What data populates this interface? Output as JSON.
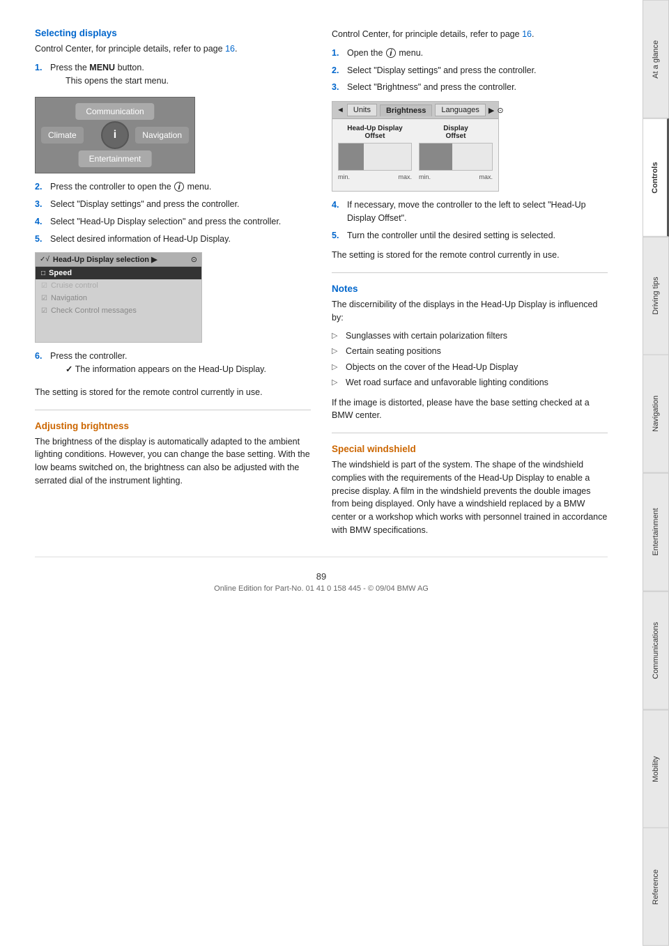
{
  "sidebar": {
    "tabs": [
      {
        "label": "At a glance",
        "active": false
      },
      {
        "label": "Controls",
        "active": true
      },
      {
        "label": "Driving tips",
        "active": false
      },
      {
        "label": "Navigation",
        "active": false
      },
      {
        "label": "Entertainment",
        "active": false
      },
      {
        "label": "Communications",
        "active": false
      },
      {
        "label": "Mobility",
        "active": false
      },
      {
        "label": "Reference",
        "active": false
      }
    ]
  },
  "left_col": {
    "selecting_displays": {
      "heading": "Selecting displays",
      "intro": "Control Center, for principle details, refer to page",
      "intro_page": "16",
      "intro_end": ".",
      "steps": [
        {
          "num": "1.",
          "text": "Press the ",
          "bold": "MENU",
          "text2": " button.",
          "sub": "This opens the start menu."
        },
        {
          "num": "2.",
          "text": "Press the controller to open the",
          "icon": "i",
          "text2": "menu."
        },
        {
          "num": "3.",
          "text": "Select \"Display settings\" and press the controller."
        },
        {
          "num": "4.",
          "text": "Select \"Head-Up Display selection\" and press the controller."
        },
        {
          "num": "5.",
          "text": "Select desired information of Head-Up Display."
        }
      ],
      "menu_items": {
        "top": "Communication",
        "left": "Climate",
        "right": "Navigation",
        "bottom": "Entertainment"
      },
      "hud_selection": {
        "header": "Head-Up Display selection",
        "items": [
          {
            "label": "Speed",
            "state": "selected"
          },
          {
            "label": "Cruise control",
            "state": "checked"
          },
          {
            "label": "Navigation",
            "state": "checked"
          },
          {
            "label": "Check Control messages",
            "state": "checked"
          }
        ]
      },
      "step6": {
        "num": "6.",
        "text": "Press the controller.",
        "sub1": "The information appears on the Head-Up Display.",
        "check_icon": "✓"
      },
      "stored_note": "The setting is stored for the remote control currently in use."
    },
    "adjusting_brightness": {
      "heading": "Adjusting brightness",
      "text": "The brightness of the display is automatically adapted to the ambient lighting conditions. However, you can change the base setting. With the low beams switched on, the brightness can also be adjusted with the serrated dial of the instrument lighting."
    }
  },
  "right_col": {
    "intro": "Control Center, for principle details, refer to page",
    "intro_page": "16",
    "intro_end": ".",
    "steps": [
      {
        "num": "1.",
        "text": "Open the",
        "icon": "i",
        "text2": "menu."
      },
      {
        "num": "2.",
        "text": "Select \"Display settings\" and press the controller."
      },
      {
        "num": "3.",
        "text": "Select \"Brightness\" and press the controller."
      }
    ],
    "brightness_display": {
      "tabs": [
        "Units",
        "Brightness",
        "Languages"
      ],
      "active_tab": "Brightness",
      "cols": [
        {
          "label": "Head-Up Display Offset",
          "min": "min.",
          "max": "max."
        },
        {
          "label": "Display Offset",
          "min": "min.",
          "max": "max."
        }
      ]
    },
    "steps2": [
      {
        "num": "4.",
        "text": "If necessary, move the controller to the left to select \"Head-Up Display Offset\"."
      },
      {
        "num": "5.",
        "text": "Turn the controller until the desired setting is selected."
      }
    ],
    "stored_note": "The setting is stored for the remote control currently in use.",
    "notes": {
      "heading": "Notes",
      "intro": "The discernibility of the displays in the Head-Up Display is influenced by:",
      "bullets": [
        "Sunglasses with certain polarization filters",
        "Certain seating positions",
        "Objects on the cover of the Head-Up Display",
        "Wet road surface and unfavorable lighting conditions"
      ],
      "closing": "If the image is distorted, please have the base setting checked at a BMW center."
    },
    "special_windshield": {
      "heading": "Special windshield",
      "text": "The windshield is part of the system. The shape of the windshield complies with the requirements of the Head-Up Display to enable a precise display. A film in the windshield prevents the double images from being displayed. Only have a windshield replaced by a BMW center or a workshop which works with personnel trained in accordance with BMW specifications."
    }
  },
  "footer": {
    "page_number": "89",
    "copyright": "Online Edition for Part-No. 01 41 0 158 445 - © 09/04 BMW AG"
  }
}
